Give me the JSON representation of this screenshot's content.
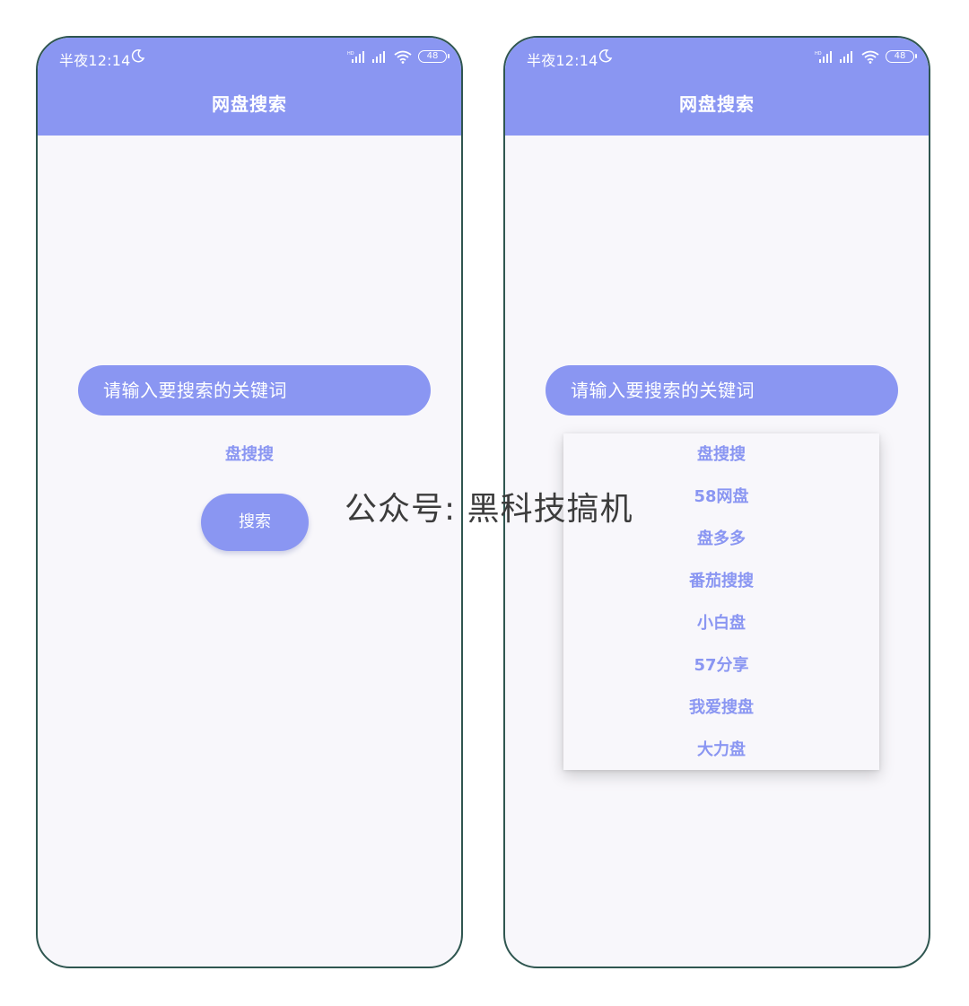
{
  "watermark": "公众号: 黑科技搞机",
  "colors": {
    "accent": "#8a96f2",
    "background": "#f8f7fb",
    "frame": "#2f5650"
  },
  "left_screen": {
    "status_bar": {
      "time": "半夜12:14",
      "battery": "48",
      "icons": [
        "moon-icon",
        "hd-signal-icon",
        "signal-icon",
        "wifi-icon",
        "battery-icon"
      ]
    },
    "app_title": "网盘搜索",
    "search_placeholder": "请输入要搜索的关键词",
    "selected_engine": "盘搜搜",
    "search_button_label": "搜索"
  },
  "right_screen": {
    "status_bar": {
      "time": "半夜12:14",
      "battery": "48",
      "icons": [
        "moon-icon",
        "hd-signal-icon",
        "signal-icon",
        "wifi-icon",
        "battery-icon"
      ]
    },
    "app_title": "网盘搜索",
    "search_placeholder": "请输入要搜索的关键词",
    "dropdown_options": [
      "盘搜搜",
      "58网盘",
      "盘多多",
      "番茄搜搜",
      "小白盘",
      "57分享",
      "我爱搜盘",
      "大力盘"
    ]
  }
}
